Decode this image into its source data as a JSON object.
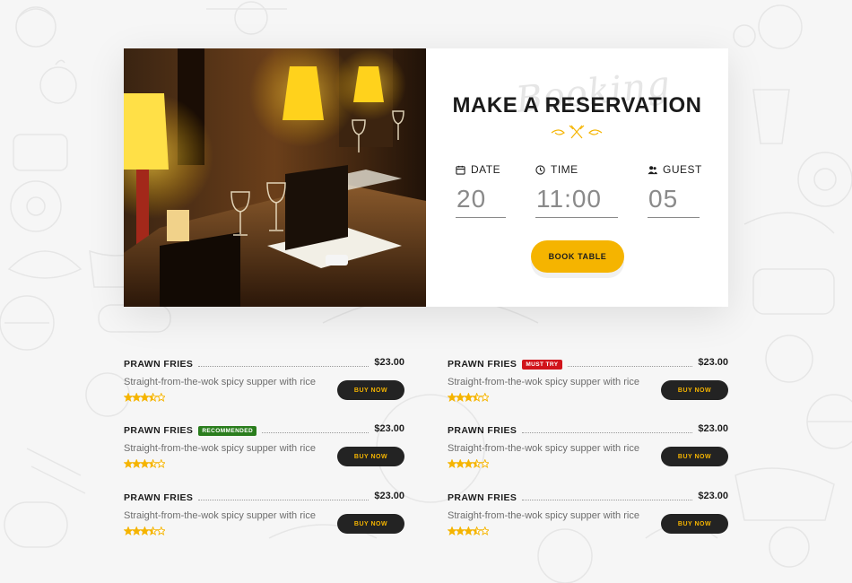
{
  "reservation": {
    "script_text": "Booking",
    "title": "MAKE A RESERVATION",
    "fields": [
      {
        "label": "DATE",
        "value": "20",
        "icon": "calendar-icon"
      },
      {
        "label": "TIME",
        "value": "11:00",
        "icon": "clock-icon"
      },
      {
        "label": "GUEST",
        "value": "05",
        "icon": "users-icon"
      }
    ],
    "book_label": "BOOK TABLE"
  },
  "menu": {
    "items": [
      {
        "name": "PRAWN FRIES",
        "badge": "",
        "price": "$23.00",
        "description": "Straight-from-the-wok spicy supper with rice",
        "rating": 3.5,
        "buy_label": "BUY NOW"
      },
      {
        "name": "PRAWN FRIES",
        "badge": "MUST TRY",
        "badge_type": "must",
        "price": "$23.00",
        "description": "Straight-from-the-wok spicy supper with rice",
        "rating": 3.5,
        "buy_label": "BUY NOW"
      },
      {
        "name": "PRAWN FRIES",
        "badge": "RECOMMENDED",
        "badge_type": "rec",
        "price": "$23.00",
        "description": "Straight-from-the-wok spicy supper with rice",
        "rating": 3.5,
        "buy_label": "BUY NOW"
      },
      {
        "name": "PRAWN FRIES",
        "badge": "",
        "price": "$23.00",
        "description": "Straight-from-the-wok spicy supper with rice",
        "rating": 3.5,
        "buy_label": "BUY NOW"
      },
      {
        "name": "PRAWN FRIES",
        "badge": "",
        "price": "$23.00",
        "description": "Straight-from-the-wok spicy supper with rice",
        "rating": 3.5,
        "buy_label": "BUY NOW"
      },
      {
        "name": "PRAWN FRIES",
        "badge": "",
        "price": "$23.00",
        "description": "Straight-from-the-wok spicy supper with rice",
        "rating": 3.5,
        "buy_label": "BUY NOW"
      }
    ]
  },
  "colors": {
    "accent": "#f5b400",
    "dark_button": "#232323",
    "badge_recommended": "#2a7d1d",
    "badge_must_try": "#d1141b"
  }
}
